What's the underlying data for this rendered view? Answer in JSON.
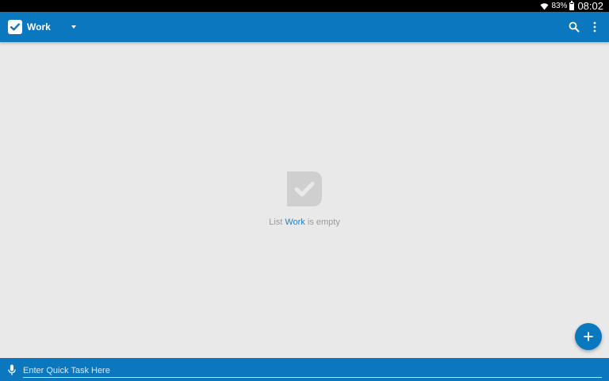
{
  "status_bar": {
    "battery_percent": "83%",
    "time": "08:02",
    "icons": [
      "wifi-icon",
      "battery-icon"
    ]
  },
  "app_bar": {
    "list_title": "Work",
    "icons": [
      "app-logo-check-icon",
      "dropdown-arrow-icon",
      "search-icon",
      "more-vert-icon"
    ]
  },
  "empty_state": {
    "prefix": "List ",
    "list_name": "Work",
    "suffix": " is empty",
    "icon": "empty-list-check-icon"
  },
  "fab": {
    "icon": "plus-icon"
  },
  "quick_task": {
    "placeholder": "Enter Quick Task Here",
    "icon": "mic-icon"
  },
  "colors": {
    "primary": "#0b77be",
    "background": "#e9e9e9",
    "accent_text": "#2c7fc0",
    "muted_text": "#9b9b9b"
  }
}
